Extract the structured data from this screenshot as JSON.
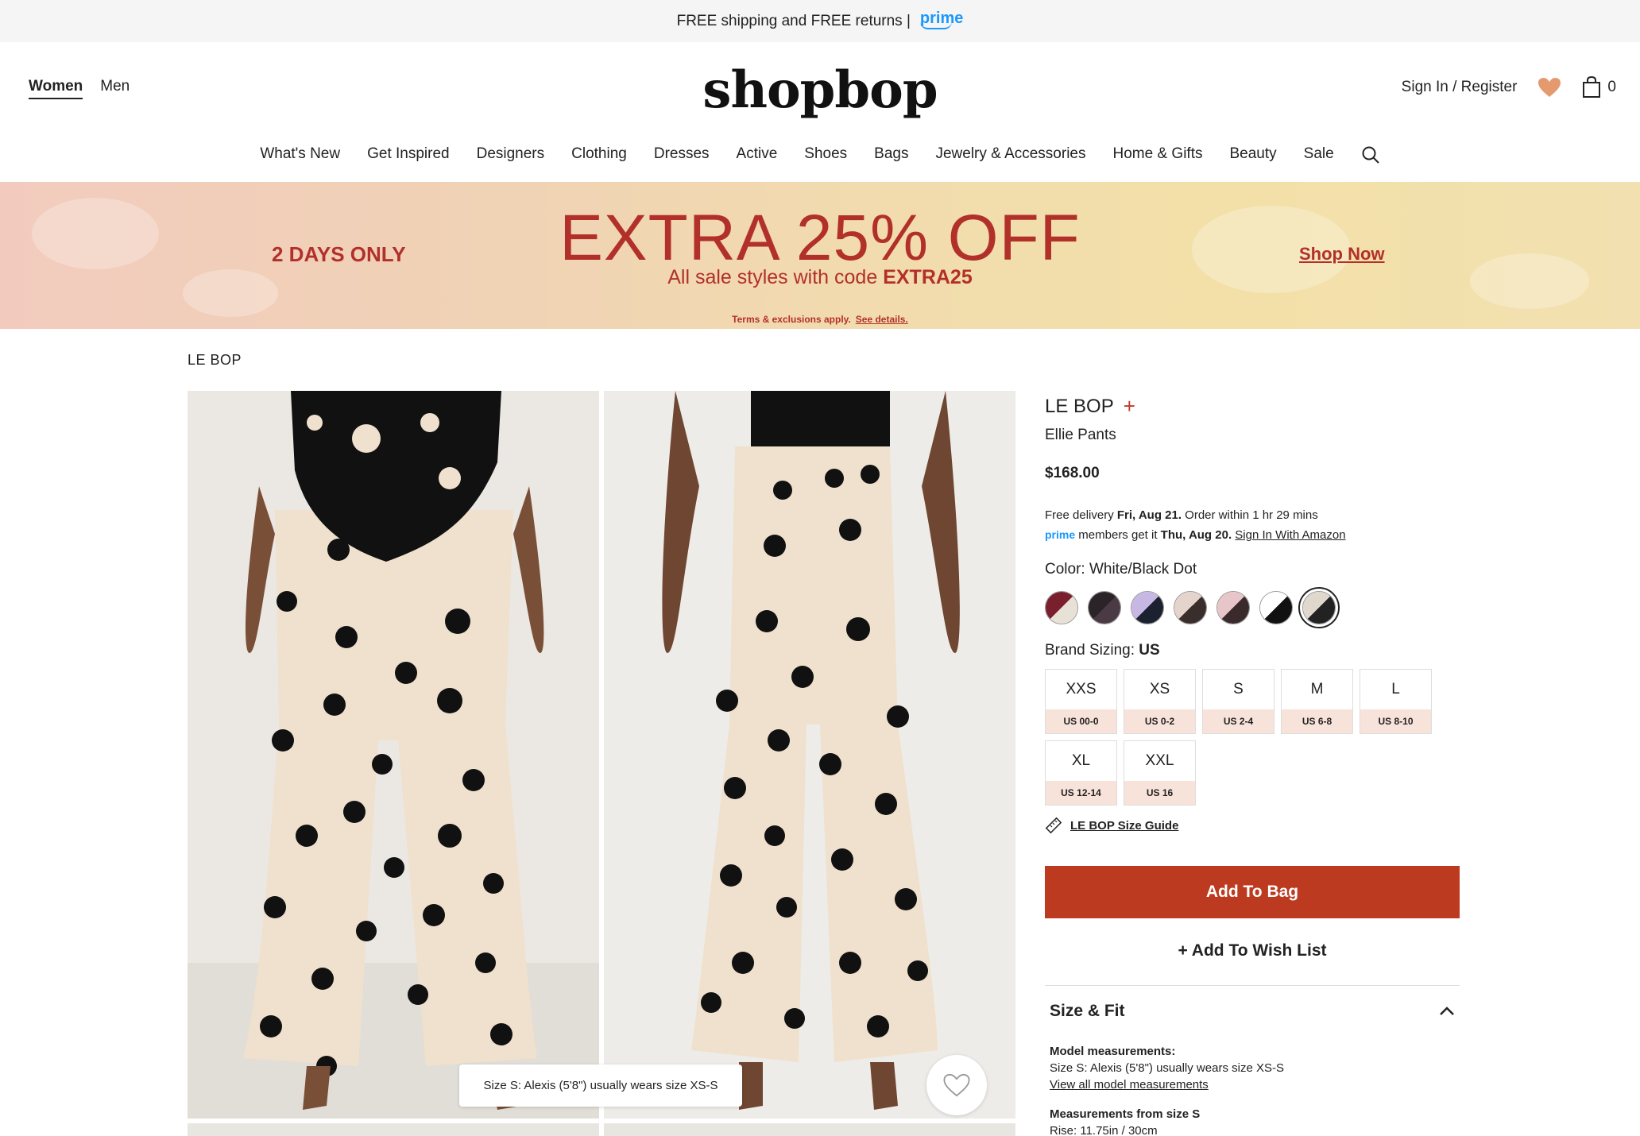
{
  "promo": {
    "text": "FREE shipping and FREE returns |",
    "prime": "prime"
  },
  "gender": {
    "women": "Women",
    "men": "Men"
  },
  "logo": "shopbop",
  "account": {
    "signin": "Sign In / Register",
    "bag_count": "0"
  },
  "nav": [
    "What's New",
    "Get Inspired",
    "Designers",
    "Clothing",
    "Dresses",
    "Active",
    "Shoes",
    "Bags",
    "Jewelry & Accessories",
    "Home & Gifts",
    "Beauty",
    "Sale"
  ],
  "banner": {
    "days": "2 DAYS ONLY",
    "headline": "EXTRA 25% OFF",
    "code_prefix": "All sale styles with code",
    "code": "EXTRA25",
    "terms": "Terms & exclusions apply.",
    "terms_link": "See details.",
    "cta": "Shop Now"
  },
  "breadcrumb": "LE BOP",
  "image_tooltip": "Size S: Alexis (5'8\") usually wears size XS-S",
  "product": {
    "brand": "LE BOP",
    "plus": "+",
    "name": "Ellie Pants",
    "price": "$168.00",
    "delivery": {
      "line1_a": "Free delivery",
      "line1_b": "Fri, Aug 21.",
      "line1_c": "Order within 1 hr 29 mins",
      "prime": "prime",
      "line2_a": "members get it",
      "line2_b": "Thu, Aug 20.",
      "line2_link": "Sign In With Amazon"
    },
    "color_label": "Color: White/Black Dot",
    "swatches": [
      {
        "a": "#7a1f2e",
        "b": "#e8e2d6"
      },
      {
        "a": "#2a2328",
        "b": "#4a3a44"
      },
      {
        "a": "#c7b8e3",
        "b": "#1c2130"
      },
      {
        "a": "#e5d4cc",
        "b": "#3a2e2c"
      },
      {
        "a": "#e8c5c8",
        "b": "#3a2a2c"
      },
      {
        "a": "#ffffff",
        "b": "#111111"
      },
      {
        "a": "#e0d8cc",
        "b": "#222222"
      }
    ],
    "sizing_label": "Brand Sizing:",
    "sizing_system": "US",
    "sizes": [
      {
        "t": "XXS",
        "u": "US 00-0"
      },
      {
        "t": "XS",
        "u": "US 0-2"
      },
      {
        "t": "S",
        "u": "US 2-4"
      },
      {
        "t": "M",
        "u": "US 6-8"
      },
      {
        "t": "L",
        "u": "US 8-10"
      },
      {
        "t": "XL",
        "u": "US 12-14"
      },
      {
        "t": "XXL",
        "u": "US 16"
      }
    ],
    "size_guide": "LE BOP Size Guide",
    "add_to_bag": "Add To Bag",
    "add_to_wish": "+ Add To Wish List"
  },
  "size_fit": {
    "title": "Size & Fit",
    "model_label": "Model measurements:",
    "model_text": "Size S: Alexis (5'8\") usually wears size XS-S",
    "model_link": "View all model measurements",
    "meas_label": "Measurements from size S",
    "rise": "Rise: 11.75in / 30cm"
  },
  "colors": {
    "accent": "#bc3a1f",
    "banner_text": "#b2302a",
    "prime": "#1a98ff"
  }
}
